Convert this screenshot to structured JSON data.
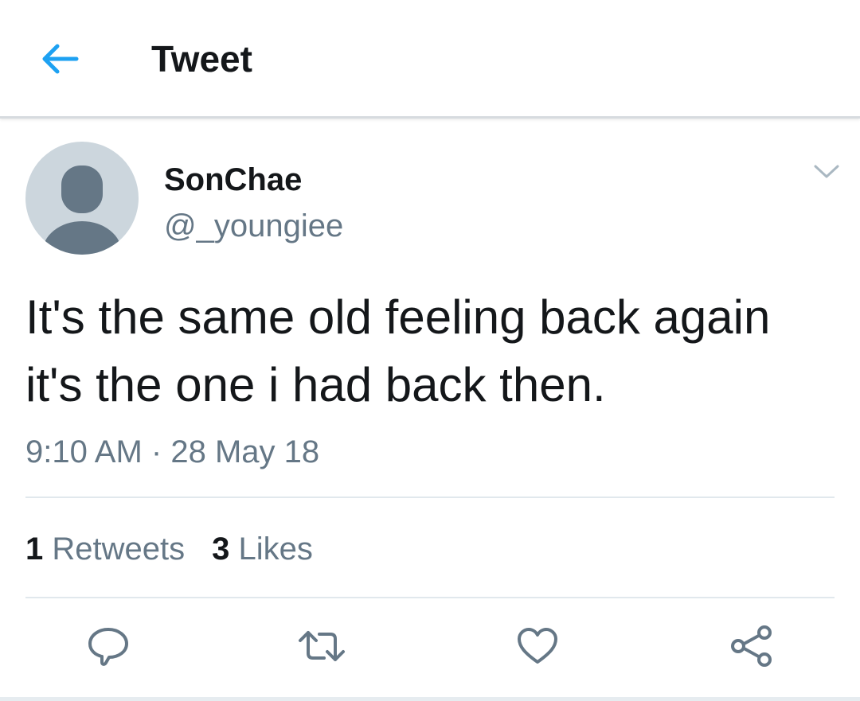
{
  "header": {
    "title": "Tweet",
    "back_icon": "arrow-left-icon",
    "accent_color": "#1da1f2"
  },
  "tweet": {
    "author": {
      "display_name": "SonChae",
      "handle": "@_youngiee"
    },
    "text": "It's the same old feeling back again it's the one i had back then.",
    "timestamp": {
      "time": "9:10 AM",
      "separator": "·",
      "date": "28 May 18"
    },
    "stats": {
      "retweets_count": "1",
      "retweets_label": "Retweets",
      "likes_count": "3",
      "likes_label": "Likes"
    },
    "actions": [
      "reply-icon",
      "retweet-icon",
      "like-icon",
      "share-icon"
    ]
  },
  "colors": {
    "text_primary": "#14171a",
    "text_secondary": "#657786",
    "divider": "#e1e8ed",
    "avatar_bg": "#ccd6dd",
    "avatar_fg": "#657786"
  }
}
